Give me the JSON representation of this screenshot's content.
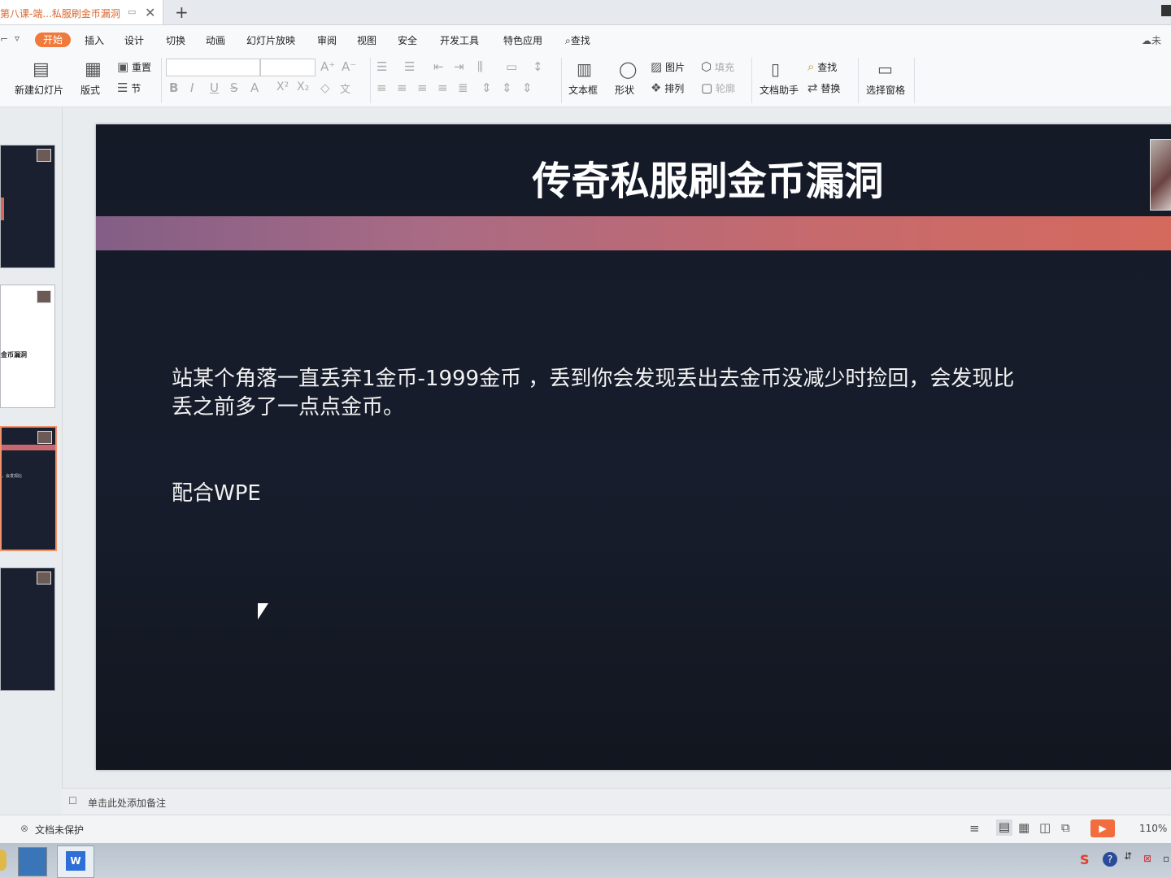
{
  "tabs": {
    "active_title": "第八课-端...私服刷金币漏洞",
    "new_tab": "+"
  },
  "menu": {
    "items": [
      "开始",
      "插入",
      "设计",
      "切换",
      "动画",
      "幻灯片放映",
      "审阅",
      "视图",
      "安全",
      "开发工具",
      "特色应用"
    ],
    "search": "查找",
    "cloud": "未"
  },
  "ribbon": {
    "new_slide": "新建幻灯片",
    "layout": "版式",
    "reset": "重置",
    "section": "节",
    "textbox": "文本框",
    "shape": "形状",
    "picture": "图片",
    "arrange": "排列",
    "fill": "填充",
    "outline": "轮廓",
    "doc_assistant": "文档助手",
    "find": "查找",
    "replace": "替换",
    "select_pane": "选择窗格"
  },
  "thumbnails": {
    "slide2_text": "金币漏洞",
    "slide3_text": "，会发现比"
  },
  "slide": {
    "title": "传奇私服刷金币漏洞",
    "body_line1": "站某个角落一直丢弃1金币-1999金币 ，丢到你会发现丢出去金币没减少时捡回，会发现比",
    "body_line2": "丢之前多了一点点金币。",
    "body_line3": "配合WPE"
  },
  "notes": {
    "placeholder": "单击此处添加备注"
  },
  "status": {
    "protection": "文档未保护",
    "zoom": "110%"
  },
  "colors": {
    "accent": "#f07a3c",
    "slide_bg": "#161b29",
    "band_start": "#835e86",
    "band_end": "#d5695d"
  }
}
